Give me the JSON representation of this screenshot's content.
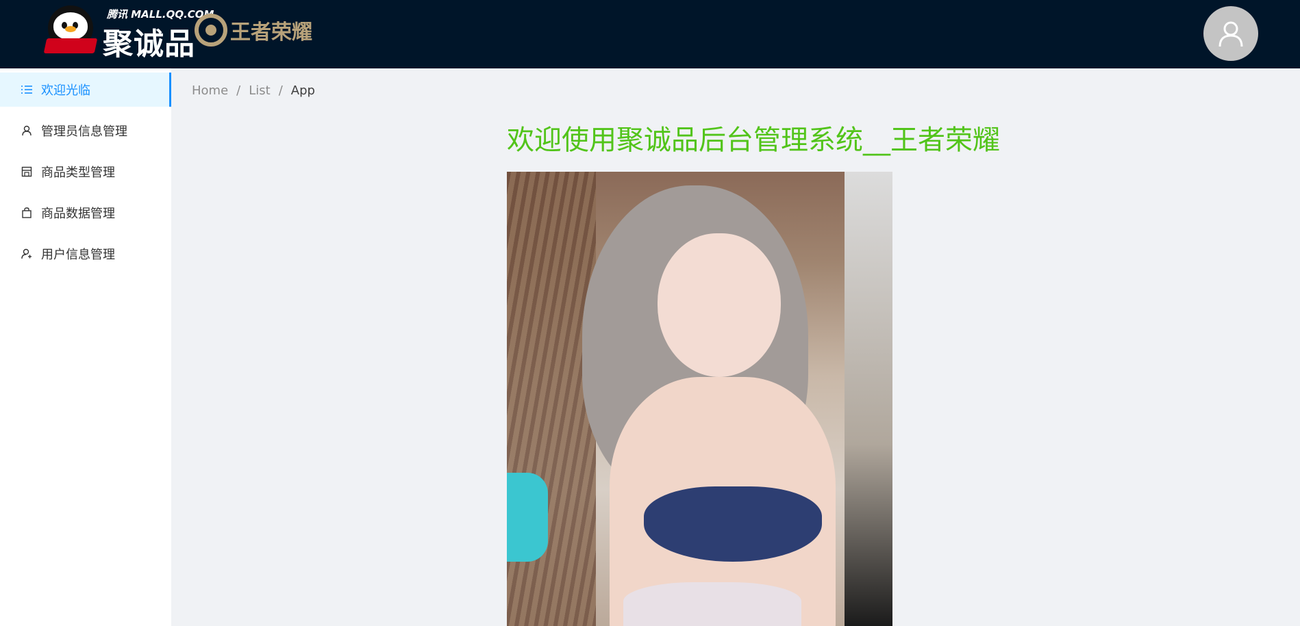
{
  "header": {
    "logo_small": "腾讯 MALL.QQ.COM",
    "logo_main": "聚诚品",
    "game_name": "王者荣耀",
    "avatar_icon": "user-icon",
    "colors": {
      "background": "#001529",
      "game_gold": "#b8a27a",
      "avatar_bg": "#c4c4c4"
    }
  },
  "sidebar": {
    "items": [
      {
        "label": "欢迎光临",
        "icon": "list-icon",
        "active": true
      },
      {
        "label": "管理员信息管理",
        "icon": "user-icon",
        "active": false
      },
      {
        "label": "商品类型管理",
        "icon": "shop-icon",
        "active": false
      },
      {
        "label": "商品数据管理",
        "icon": "shopping-bag-icon",
        "active": false
      },
      {
        "label": "用户信息管理",
        "icon": "user-add-icon",
        "active": false
      }
    ],
    "colors": {
      "active_bg": "#e6f7ff",
      "active_text": "#1890ff"
    }
  },
  "breadcrumb": {
    "items": [
      "Home",
      "List",
      "App"
    ],
    "separator": "/"
  },
  "main": {
    "welcome_title": "欢迎使用聚诚品后台管理系统__王者荣耀",
    "title_color": "#52c41a"
  }
}
